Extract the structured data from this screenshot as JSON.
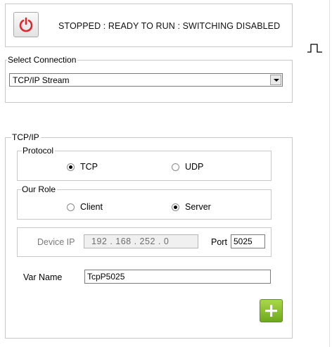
{
  "status": {
    "text": "STOPPED : READY TO RUN : SWITCHING DISABLED",
    "power_icon": "power-icon",
    "power_color": "#e3242b"
  },
  "side": {
    "icon": "pulse-icon"
  },
  "connection": {
    "group_label": "Select Connection",
    "selected": "TCP/IP Stream"
  },
  "tcpip": {
    "group_label": "TCP/IP",
    "protocol": {
      "label": "Protocol",
      "options": [
        {
          "label": "TCP",
          "checked": true
        },
        {
          "label": "UDP",
          "checked": false
        }
      ]
    },
    "role": {
      "label": "Our Role",
      "options": [
        {
          "label": "Client",
          "checked": false
        },
        {
          "label": "Server",
          "checked": true
        }
      ]
    },
    "device": {
      "ip_label": "Device IP",
      "ip_value": "192 . 168 . 252 .  0",
      "port_label": "Port",
      "port_value": "5025"
    },
    "var": {
      "label": "Var Name",
      "value": "TcpP5025"
    },
    "add_icon": "plus-icon",
    "add_symbol": "+",
    "accent": "#7ab829"
  }
}
